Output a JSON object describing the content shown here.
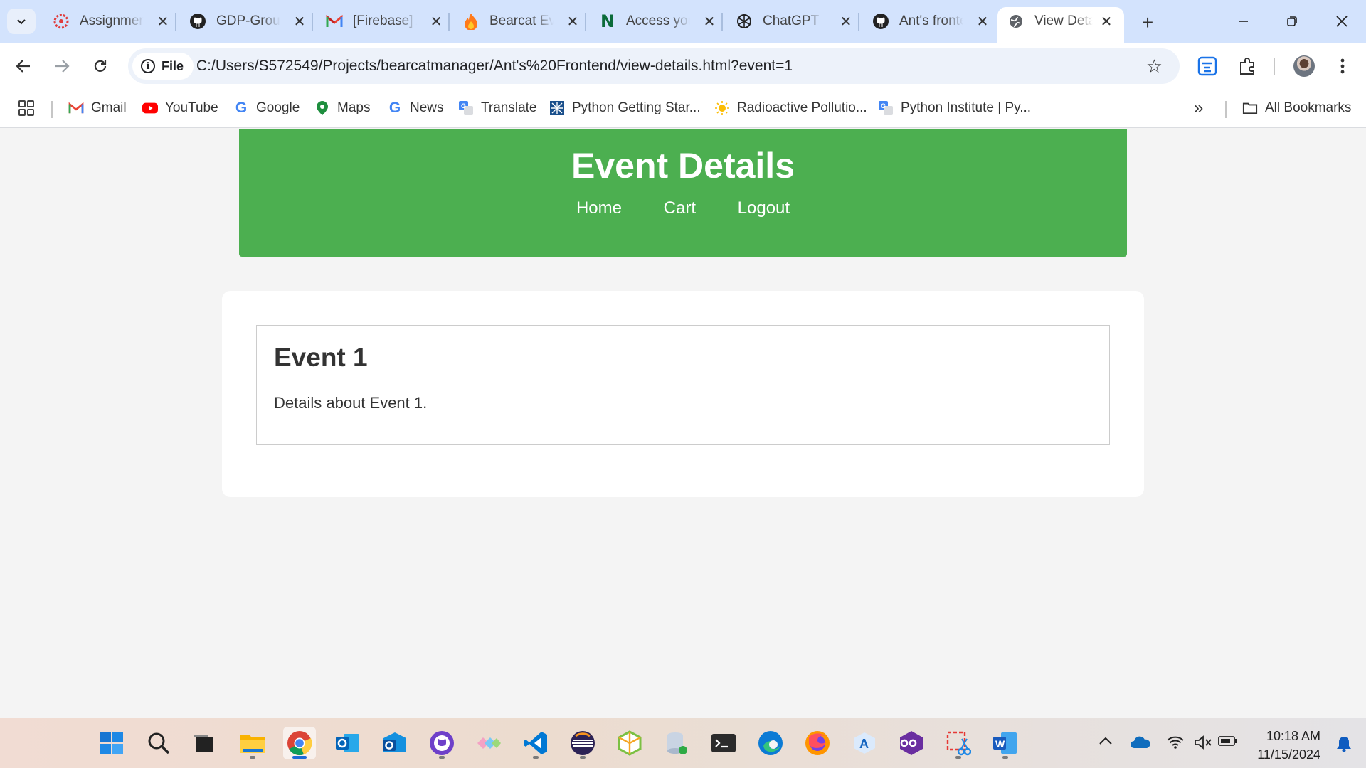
{
  "browser": {
    "tabs": [
      {
        "title": "Assignments",
        "icon": "canvas-icon",
        "active": false
      },
      {
        "title": "GDP-Group",
        "icon": "github-icon",
        "active": false
      },
      {
        "title": "[Firebase] Access",
        "icon": "gmail-icon",
        "active": false
      },
      {
        "title": "Bearcat Events",
        "icon": "firebase-icon",
        "active": false
      },
      {
        "title": "Access your",
        "icon": "notion-icon",
        "active": false
      },
      {
        "title": "ChatGPT",
        "icon": "chatgpt-icon",
        "active": false
      },
      {
        "title": "Ant's frontend",
        "icon": "github-icon",
        "active": false
      },
      {
        "title": "View Details",
        "icon": "globe-icon",
        "active": true
      }
    ],
    "address": {
      "chip_label": "File",
      "url": "C:/Users/S572549/Projects/bearcatmanager/Ant's%20Frontend/view-details.html?event=1"
    },
    "bookmarks": [
      {
        "label": "Gmail",
        "icon": "gmail-icon"
      },
      {
        "label": "YouTube",
        "icon": "youtube-icon"
      },
      {
        "label": "Google",
        "icon": "google-icon"
      },
      {
        "label": "Maps",
        "icon": "maps-icon"
      },
      {
        "label": "News",
        "icon": "google-news-icon"
      },
      {
        "label": "Translate",
        "icon": "translate-icon"
      },
      {
        "label": "Python Getting Star...",
        "icon": "python-icon"
      },
      {
        "label": "Radioactive Pollutio...",
        "icon": "sun-icon"
      },
      {
        "label": "Python Institute | Py...",
        "icon": "translate-icon"
      }
    ],
    "all_bookmarks_label": "All Bookmarks"
  },
  "page": {
    "header_title": "Event Details",
    "nav": [
      "Home",
      "Cart",
      "Logout"
    ],
    "event": {
      "title": "Event 1",
      "description": "Details about Event 1."
    },
    "colors": {
      "header_bg": "#4caf50",
      "page_bg": "#f4f4f4"
    }
  },
  "taskbar": {
    "apps": [
      "windows-start-icon",
      "search-icon",
      "task-view-icon",
      "file-explorer-icon",
      "chrome-icon",
      "outlook-icon",
      "outlook-new-icon",
      "github-desktop-icon",
      "git-icon",
      "vscode-icon",
      "eclipse-icon",
      "box-icon",
      "database-icon",
      "terminal-icon",
      "edge-icon",
      "firefox-icon",
      "font-app-icon",
      "visual-studio-icon",
      "snipping-tool-icon",
      "word-icon"
    ],
    "time": "10:18 AM",
    "date": "11/15/2024"
  }
}
